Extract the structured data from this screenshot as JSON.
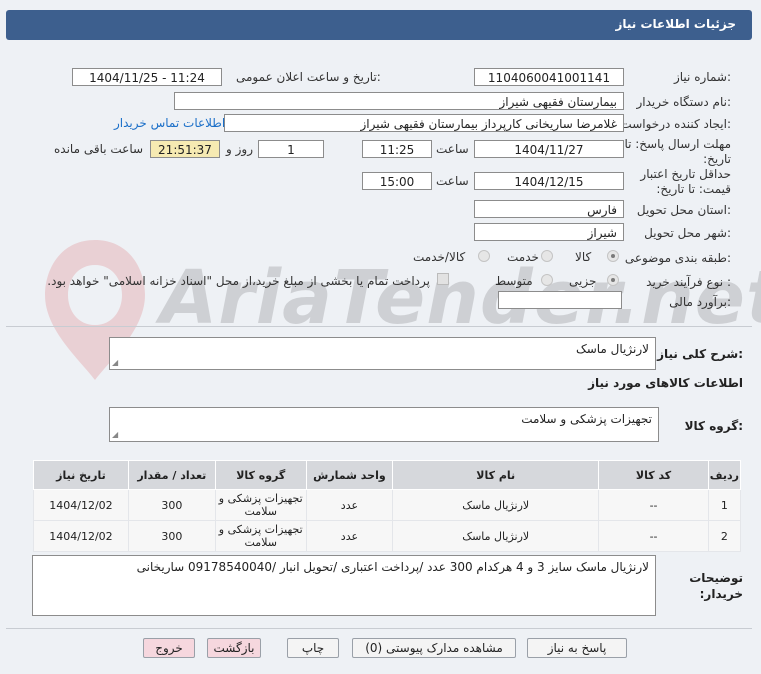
{
  "header": {
    "title": "جزئیات اطلاعات نیاز"
  },
  "form": {
    "need_number": {
      "label": "شماره نیاز:",
      "value": "1104060041001141"
    },
    "announce_datetime": {
      "label": "تاریخ و ساعت اعلان عمومی:",
      "value": "1404/11/25 - 11:24"
    },
    "buyer_org": {
      "label": "نام دستگاه خریدار:",
      "value": "بیمارستان فقیهی شیراز"
    },
    "requester": {
      "label": "ایجاد کننده درخواست:",
      "value": "غلامرضا ساریخانی کارپرداز بیمارستان فقیهی شیراز",
      "contact_link": "اطلاعات تماس خریدار"
    },
    "reply_deadline": {
      "label": "مهلت ارسال پاسخ: تا تاریخ:",
      "date": "1404/11/27",
      "time_label": "ساعت",
      "time": "11:25",
      "days": "1",
      "days_label": "روز و",
      "remaining": "21:51:37",
      "remaining_label": "ساعت باقی مانده"
    },
    "price_validity": {
      "label": "حداقل تاریخ اعتبار قیمت: تا تاریخ:",
      "date": "1404/12/15",
      "time_label": "ساعت",
      "time": "15:00"
    },
    "province": {
      "label": "استان محل تحویل:",
      "value": "فارس"
    },
    "city": {
      "label": "شهر محل تحویل:",
      "value": "شیراز"
    },
    "category": {
      "label": "طبقه بندی موضوعی:",
      "options": [
        "کالا",
        "خدمت",
        "کالا/خدمت"
      ],
      "selected": "کالا"
    },
    "process": {
      "label": "نوع فرآیند خرید :",
      "options": [
        "جزیی",
        "متوسط"
      ],
      "selected": "جزیی",
      "payment_note": "پرداخت تمام یا بخشی از مبلغ خرید،از محل \"اسناد خزانه اسلامی\" خواهد بود."
    },
    "estimate": {
      "label": "برآورد مالی:",
      "value": ""
    }
  },
  "need_description": {
    "label": "شرح کلی نیاز:",
    "value": "لارنژیال ماسک"
  },
  "goods_section": {
    "title": "اطلاعات کالاهای مورد نیاز"
  },
  "goods_group": {
    "label": "گروه کالا:",
    "value": "تجهیزات پزشکی و سلامت"
  },
  "table": {
    "headers": [
      "ردیف",
      "کد کالا",
      "نام کالا",
      "واحد شمارش",
      "گروه کالا",
      "تعداد / مقدار",
      "تاریخ نیاز"
    ],
    "rows": [
      [
        "1",
        "--",
        "لارنژیال ماسک",
        "عدد",
        "تجهیزات پزشکی و سلامت",
        "300",
        "1404/12/02"
      ],
      [
        "2",
        "--",
        "لارنژیال ماسک",
        "عدد",
        "تجهیزات پزشکی و سلامت",
        "300",
        "1404/12/02"
      ]
    ]
  },
  "buyer_notes": {
    "label": "توضیحات خریدار:",
    "value": "لارنژیال ماسک سایز 3 و 4 هرکدام 300 عدد /پرداخت اعتباری /تحویل انبار /09178540040 ساریخانی"
  },
  "buttons": {
    "reply": "پاسخ به نیاز",
    "attachments": "مشاهده مدارک پیوستی (0)",
    "print": "چاپ",
    "back": "بازگشت",
    "exit": "خروج"
  },
  "watermark": {
    "text": "AriaTender.net"
  },
  "colors": {
    "header_bg": "#3d5f8e",
    "link": "#1b6fc8",
    "exit_bg": "#f6d7de"
  }
}
